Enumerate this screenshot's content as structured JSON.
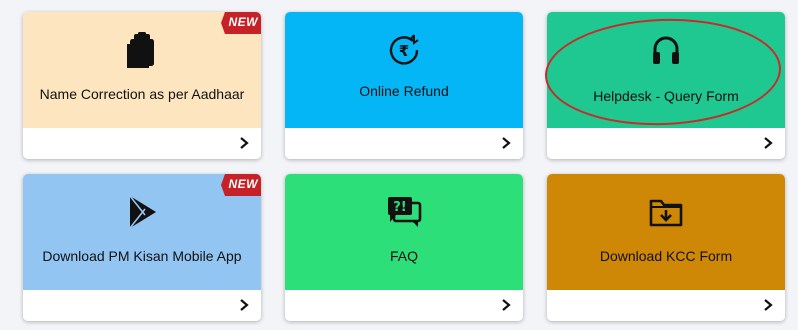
{
  "cards": [
    {
      "label": "Name Correction as per Aadhaar",
      "color": "#fde6bf",
      "icon": "clipboard-icon",
      "badge": "NEW"
    },
    {
      "label": "Online Refund",
      "color": "#04b6f5",
      "icon": "rupee-refund-icon",
      "badge": ""
    },
    {
      "label": "Helpdesk - Query Form",
      "color": "#1fc890",
      "icon": "headphones-icon",
      "badge": ""
    },
    {
      "label": "Download PM Kisan Mobile App",
      "color": "#93c5f3",
      "icon": "play-store-icon",
      "badge": "NEW"
    },
    {
      "label": "FAQ",
      "color": "#2ddf78",
      "icon": "faq-icon",
      "badge": ""
    },
    {
      "label": "Download KCC Form",
      "color": "#cf8806",
      "icon": "folder-download-icon",
      "badge": ""
    }
  ],
  "badge_color": "#c62127",
  "highlight_color": "#c92a2a"
}
